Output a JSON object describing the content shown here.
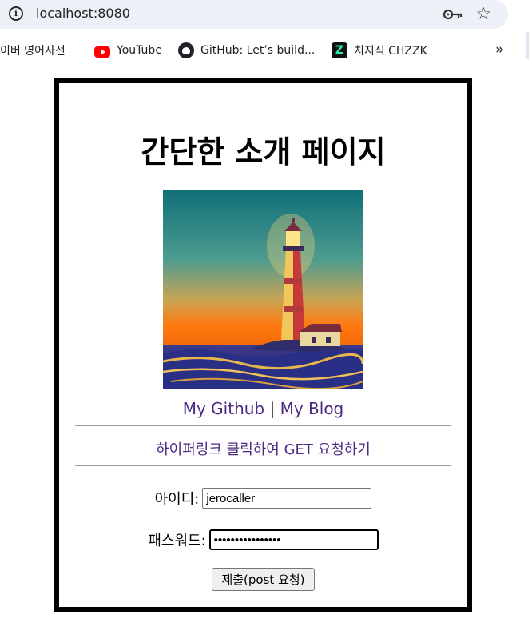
{
  "browser": {
    "url": "localhost:8080",
    "bookmarks": [
      {
        "label": "이버 영어사전",
        "icon": "none"
      },
      {
        "label": "YouTube",
        "icon": "youtube-icon"
      },
      {
        "label": "GitHub: Let’s build...",
        "icon": "github-icon"
      },
      {
        "label": "치지직 CHZZK",
        "icon": "chzzk-icon",
        "glyph": "Z"
      }
    ],
    "overflow_glyph": "»",
    "star_glyph": "☆"
  },
  "page": {
    "title": "간단한 소개 페이지",
    "image": {
      "description_icon": "lighthouse-image"
    },
    "links": {
      "github": "My Github",
      "separator": "|",
      "blog": "My Blog"
    },
    "get_link": "하이퍼링크 클릭하여 GET 요청하기",
    "form": {
      "id_label": "아이디:",
      "id_value": "jerocaller",
      "password_label": "패스워드:",
      "password_value": "••••••••••••••••",
      "submit_label": "제출(post 요청)"
    }
  },
  "colors": {
    "link": "#4b2a83",
    "omnibox_bg": "#edf0f7",
    "border": "#000000"
  }
}
